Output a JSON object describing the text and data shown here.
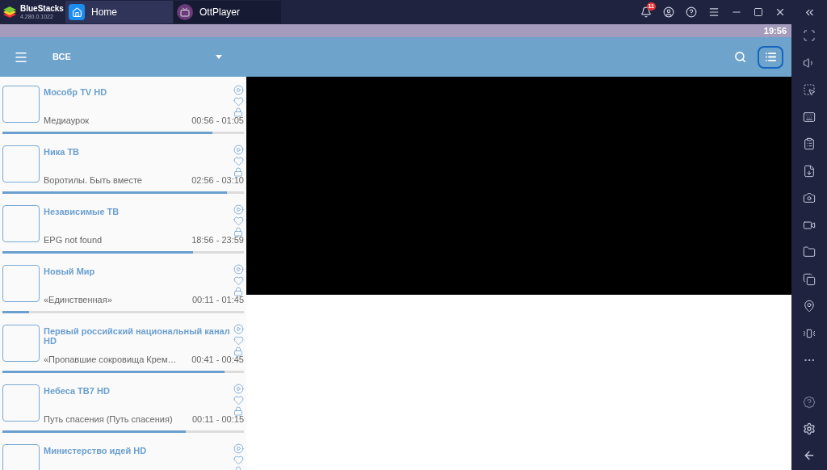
{
  "emulator": {
    "brand": "BlueStacks",
    "version": "4.280.0.1022",
    "tabs": [
      {
        "label": "Home",
        "selected": false
      },
      {
        "label": "OttPlayer",
        "selected": true
      }
    ],
    "notification_count": "11"
  },
  "status_bar": {
    "time": "19:56"
  },
  "app_bar": {
    "category": "ВСЕ"
  },
  "channels": [
    {
      "name": "Мособр TV HD",
      "program": "Медиаурок",
      "time": "00:56 - 01:05",
      "level": 0.87
    },
    {
      "name": "Ника ТВ",
      "program": "Воротилы. Быть вместе",
      "time": "02:56 - 03:10",
      "level": 0.93
    },
    {
      "name": "Независимые ТВ",
      "program": "EPG not found",
      "time": "18:56 - 23:59",
      "level": 0.79
    },
    {
      "name": "Новый Мир",
      "program": "«Единственная»",
      "time": "00:11 - 01:45",
      "level": 0.11
    },
    {
      "name": "Первый российский национальный канал HD",
      "program": "«Пропавшие сокровища Крем…",
      "time": "00:41 - 00:45",
      "level": 0.92
    },
    {
      "name": "Небеса ТВ7 HD",
      "program": "Путь спасения (Путь спасения)",
      "time": "00:11 - 00:15",
      "level": 0.76
    },
    {
      "name": "Министерство идей HD"
    }
  ]
}
